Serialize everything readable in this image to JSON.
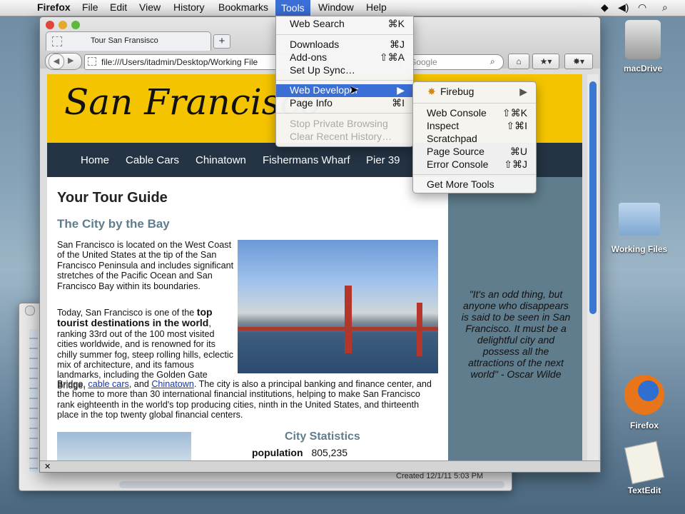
{
  "menubar": {
    "app": "Firefox",
    "items": [
      "File",
      "Edit",
      "View",
      "History",
      "Bookmarks",
      "Tools",
      "Window",
      "Help"
    ]
  },
  "tools_menu": {
    "items": [
      {
        "label": "Web Search",
        "shortcut": "⌘K"
      },
      {
        "label": "Downloads",
        "shortcut": "⌘J"
      },
      {
        "label": "Add-ons",
        "shortcut": "⇧⌘A"
      },
      {
        "label": "Set Up Sync…",
        "shortcut": ""
      },
      {
        "label": "Web Developer",
        "shortcut": "▶"
      },
      {
        "label": "Page Info",
        "shortcut": "⌘I"
      },
      {
        "label": "Stop Private Browsing",
        "shortcut": ""
      },
      {
        "label": "Clear Recent History…",
        "shortcut": ""
      }
    ]
  },
  "webdev_menu": {
    "items": [
      {
        "label": "Firebug",
        "shortcut": "▶"
      },
      {
        "label": "Web Console",
        "shortcut": "⇧⌘K"
      },
      {
        "label": "Inspect",
        "shortcut": "⇧⌘I"
      },
      {
        "label": "Scratchpad",
        "shortcut": ""
      },
      {
        "label": "Page Source",
        "shortcut": "⌘U"
      },
      {
        "label": "Error Console",
        "shortcut": "⇧⌘J"
      },
      {
        "label": "Get More Tools",
        "shortcut": ""
      }
    ]
  },
  "browser": {
    "tab_title": "Tour San Fransisco",
    "url": "file:///Users/itadmin/Desktop/Working File",
    "search_placeholder": "Google"
  },
  "page": {
    "logo": "San Francisco",
    "nav": [
      "Home",
      "Cable Cars",
      "Chinatown",
      "Fishermans Wharf",
      "Pier 39"
    ],
    "heading": "Your Tour Guide",
    "subheading": "The City by the Bay",
    "para1": "San Francisco is located on the West Coast of the United States at the tip of the San Francisco Peninsula and includes significant stretches of the Pacific Ocean and San Francisco Bay within its boundaries.",
    "para2_start": "Today, San Francisco is one of the ",
    "para2_bold": "top tourist destinations in the world",
    "para2_mid": ", ranking 33rd out of the 100 most visited cities worldwide, and is renowned for its chilly summer fog, steep rolling hills, eclectic mix of architecture, and its famous landmarks, including the Golden Gate Bridge, ",
    "link1": "cable cars",
    "and_text": ", and ",
    "link2": "Chinatown",
    "para2_end": ". The city is also a principal banking and finance center, and the home to more than 30 international financial institutions, helping to make San Francisco rank eighteenth in the world's top producing cities, ninth in the United States, and thirteenth place in the top twenty global financial centers.",
    "quote": "\"It's an odd thing, but anyone who disappears is said to be seen in San Francisco. It must be a delightful city and possess all the attractions of the next world\" - Oscar Wilde",
    "stats_heading": "City Statistics",
    "population_label": "population",
    "population_value": "805,235"
  },
  "back_window": {
    "created": "Created  12/1/11 5:03 PM"
  },
  "desktop_icons": [
    "macDrive",
    "Working Files",
    "Firefox",
    "TextEdit"
  ]
}
